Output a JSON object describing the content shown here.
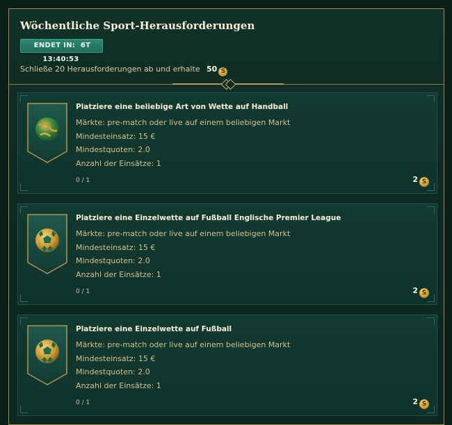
{
  "header": {
    "title": "Wöchentliche Sport-Herausforderungen",
    "timer_label": "ENDET IN:",
    "timer_value": "6T 13:40:53",
    "summary_text": "Schließe 20 Herausforderungen ab und erhalte",
    "summary_reward": "50",
    "currency_symbol": "S"
  },
  "challenges": [
    {
      "title": "Platziere eine beliebige Art von Wette auf Handball",
      "markets": "Märkte: pre-match oder live auf einem beliebigen Markt",
      "min_stake": "Mindesteinsatz: 15 €",
      "min_odds": "Mindestquoten: 2.0",
      "stake_count": "Anzahl der Einsätze: 1",
      "progress": "0 / 1",
      "reward": "2",
      "icon": "handball-icon",
      "ball_color": "green-gold"
    },
    {
      "title": "Platziere eine Einzelwette auf Fußball Englische Premier League",
      "markets": "Märkte: pre-match oder live auf einem beliebigen Markt",
      "min_stake": "Mindesteinsatz: 15 €",
      "min_odds": "Mindestquoten: 2.0",
      "stake_count": "Anzahl der Einsätze: 1",
      "progress": "0 / 1",
      "reward": "2",
      "icon": "football-icon",
      "ball_color": "gold-green"
    },
    {
      "title": "Platziere eine Einzelwette auf Fußball",
      "markets": "Märkte: pre-match oder live auf einem beliebigen Markt",
      "min_stake": "Mindesteinsatz: 15 €",
      "min_odds": "Mindestquoten: 2.0",
      "stake_count": "Anzahl der Einsätze: 1",
      "progress": "0 / 1",
      "reward": "2",
      "icon": "football-icon",
      "ball_color": "gold-green"
    }
  ],
  "colors": {
    "background": "#0b1f19",
    "panel_border": "#a68a4c",
    "card_bg": "#113a31",
    "accent_teal": "#2f8a74",
    "gold": "#c99a35",
    "text_gold": "#d4c08e"
  }
}
